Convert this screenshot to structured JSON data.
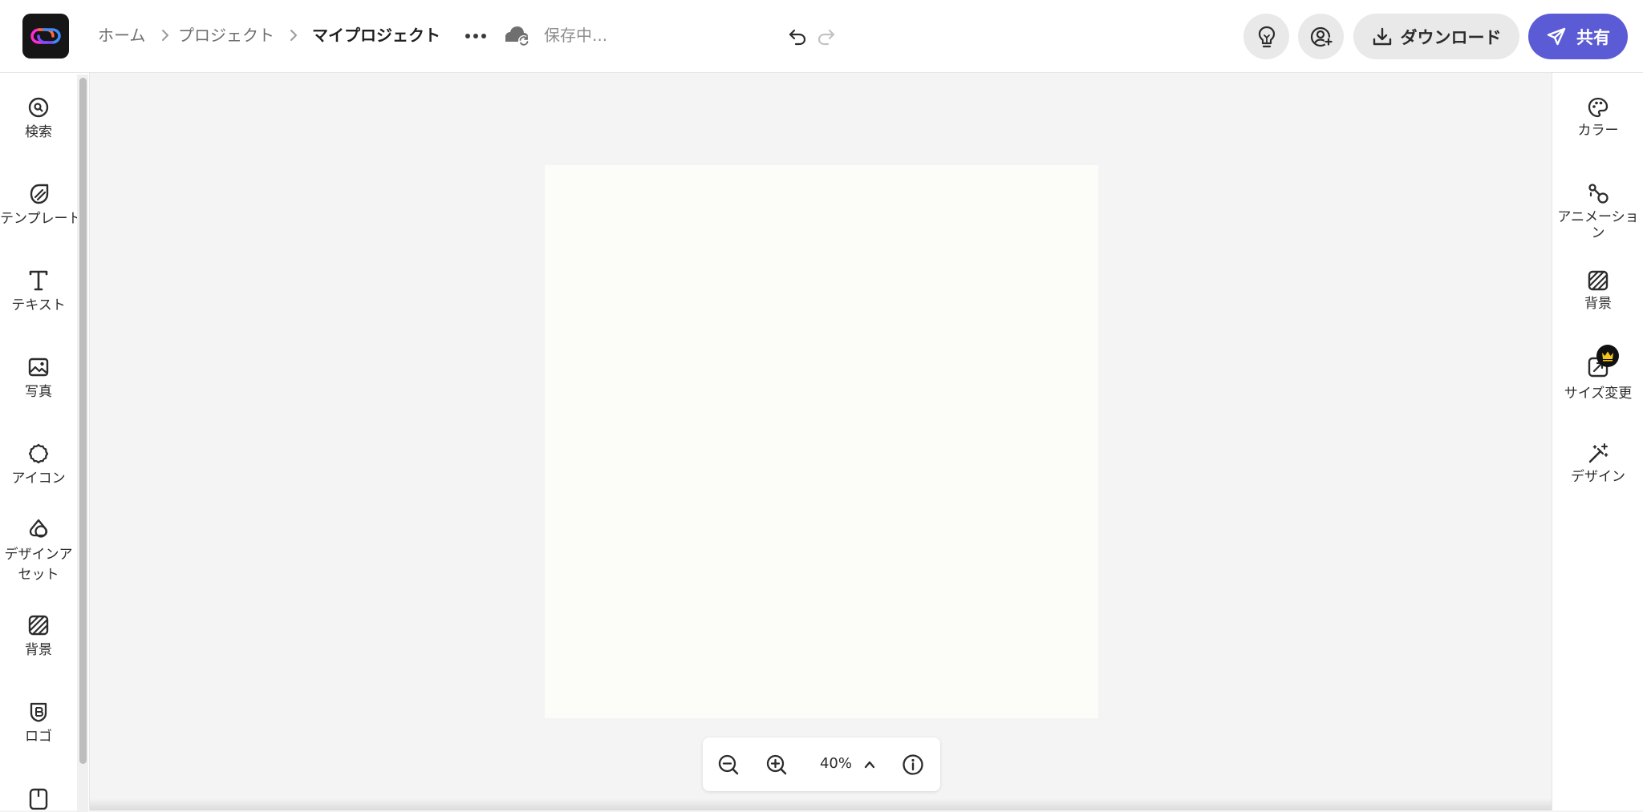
{
  "header": {
    "breadcrumb": [
      "ホーム",
      "プロジェクト",
      "マイプロジェクト"
    ],
    "save_status": "保存中...",
    "download_label": "ダウンロード",
    "share_label": "共有"
  },
  "left_nav": [
    {
      "label": "検索",
      "icon": "search-icon"
    },
    {
      "label": "テンプレート",
      "icon": "template-icon"
    },
    {
      "label": "テキスト",
      "icon": "text-icon"
    },
    {
      "label": "写真",
      "icon": "photo-icon"
    },
    {
      "label": "アイコン",
      "icon": "shapes-icon"
    },
    {
      "label": "デザインアセット",
      "icon": "design-assets-icon"
    },
    {
      "label": "背景",
      "icon": "background-icon"
    },
    {
      "label": "ロゴ",
      "icon": "logo-icon"
    }
  ],
  "right_nav": [
    {
      "label": "カラー",
      "icon": "palette-icon"
    },
    {
      "label": "アニメーション",
      "icon": "animation-icon"
    },
    {
      "label": "背景",
      "icon": "background-icon"
    },
    {
      "label": "サイズ変更",
      "icon": "resize-icon",
      "premium": true
    },
    {
      "label": "デザイン",
      "icon": "magic-wand-icon"
    }
  ],
  "zoom": {
    "value": "40%"
  },
  "colors": {
    "accent": "#5b5bd6",
    "artboard": "#fcfcf8",
    "canvas": "#f4f4f4"
  }
}
